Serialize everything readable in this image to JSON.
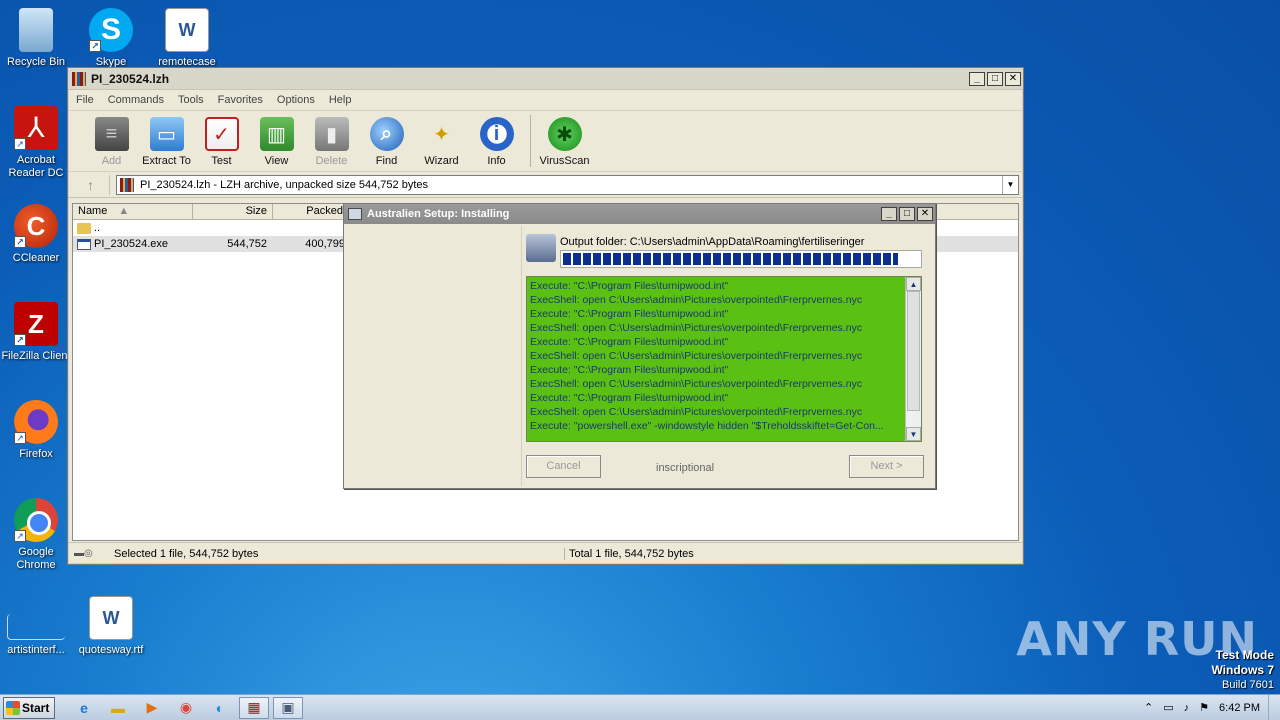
{
  "desktop": {
    "icons": [
      {
        "label": "Recycle Bin"
      },
      {
        "label": "Skype"
      },
      {
        "label": "remotecase"
      },
      {
        "label": "Acrobat Reader DC"
      },
      {
        "label": "CCleaner"
      },
      {
        "label": "FileZilla Client"
      },
      {
        "label": "Firefox"
      },
      {
        "label": "Google Chrome"
      },
      {
        "label": "artistinterf..."
      },
      {
        "label": "quotesway.rtf"
      }
    ]
  },
  "winrar": {
    "title": "PI_230524.lzh",
    "menu": [
      "File",
      "Commands",
      "Tools",
      "Favorites",
      "Options",
      "Help"
    ],
    "toolbar": [
      {
        "label": "Add",
        "icon": "add-archive-icon",
        "enabled": false
      },
      {
        "label": "Extract To",
        "icon": "extract-folder-icon",
        "enabled": true
      },
      {
        "label": "Test",
        "icon": "test-clipboard-icon",
        "enabled": true
      },
      {
        "label": "View",
        "icon": "view-book-icon",
        "enabled": true
      },
      {
        "label": "Delete",
        "icon": "trash-icon",
        "enabled": false
      },
      {
        "label": "Find",
        "icon": "magnifier-icon",
        "enabled": true
      },
      {
        "label": "Wizard",
        "icon": "wand-icon",
        "enabled": true
      },
      {
        "label": "Info",
        "icon": "info-icon",
        "enabled": true
      },
      {
        "label": "VirusScan",
        "icon": "bug-icon",
        "enabled": true
      }
    ],
    "address": "PI_230524.lzh - LZH archive, unpacked size 544,752 bytes",
    "columns": {
      "name": "Name",
      "size": "Size",
      "packed": "Packed"
    },
    "rows": [
      {
        "name": "..",
        "size": "",
        "packed": ""
      },
      {
        "name": "PI_230524.exe",
        "size": "544,752",
        "packed": "400,799"
      }
    ],
    "status_left": "Selected 1 file, 544,752 bytes",
    "status_right": "Total 1 file, 544,752 bytes"
  },
  "setup": {
    "title": "Australien Setup: Installing",
    "output_label": "Output folder: C:\\Users\\admin\\AppData\\Roaming\\fertiliseringer",
    "progress": 1.0,
    "log": [
      "Execute: \"C:\\Program Files\\turnipwood.int\"",
      "ExecShell: open C:\\Users\\admin\\Pictures\\overpointed\\Frerprvernes.nyc",
      "Execute: \"C:\\Program Files\\turnipwood.int\"",
      "ExecShell: open C:\\Users\\admin\\Pictures\\overpointed\\Frerprvernes.nyc",
      "Execute: \"C:\\Program Files\\turnipwood.int\"",
      "ExecShell: open C:\\Users\\admin\\Pictures\\overpointed\\Frerprvernes.nyc",
      "Execute: \"C:\\Program Files\\turnipwood.int\"",
      "ExecShell: open C:\\Users\\admin\\Pictures\\overpointed\\Frerprvernes.nyc",
      "Execute: \"C:\\Program Files\\turnipwood.int\"",
      "ExecShell: open C:\\Users\\admin\\Pictures\\overpointed\\Frerprvernes.nyc",
      "Execute: \"powershell.exe\" -windowstyle hidden \"$Treholdsskiftet=Get-Con..."
    ],
    "cancel_label": "Cancel",
    "brand_text": "inscriptional",
    "next_label": "Next >"
  },
  "watermark": {
    "text": "ANY RUN",
    "test_mode": "Test Mode",
    "windows": "Windows 7",
    "build": "Build 7601"
  },
  "taskbar": {
    "start_label": "Start",
    "clock": "6:42 PM"
  }
}
